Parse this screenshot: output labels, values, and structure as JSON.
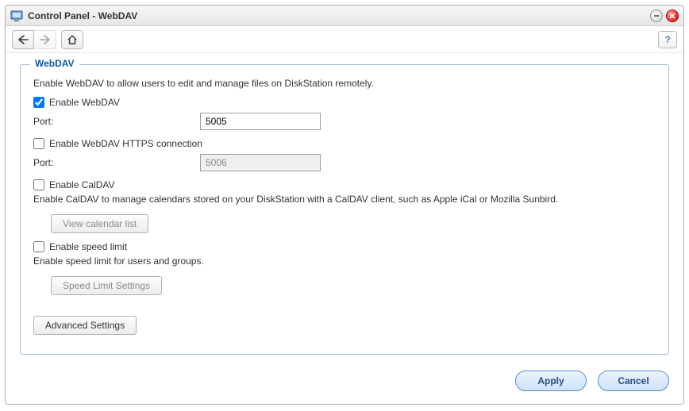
{
  "window": {
    "title": "Control Panel - WebDAV"
  },
  "section": {
    "legend": "WebDAV",
    "description": "Enable WebDAV to allow users to edit and manage files on DiskStation remotely.",
    "enable_webdav": {
      "label": "Enable WebDAV",
      "checked": true,
      "port_label": "Port:",
      "port_value": "5005"
    },
    "enable_https": {
      "label": "Enable WebDAV HTTPS connection",
      "checked": false,
      "port_label": "Port:",
      "port_value": "5006"
    },
    "enable_caldav": {
      "label": "Enable CalDAV",
      "checked": false,
      "note": "Enable CalDAV to manage calendars stored on your DiskStation with a CalDAV client, such as Apple iCal or Mozilla Sunbird.",
      "view_button": "View calendar list"
    },
    "speed_limit": {
      "label": "Enable speed limit",
      "checked": false,
      "note": "Enable speed limit for users and groups.",
      "settings_button": "Speed Limit Settings"
    },
    "advanced_button": "Advanced Settings"
  },
  "footer": {
    "apply": "Apply",
    "cancel": "Cancel"
  },
  "icons": {
    "help": "?"
  }
}
